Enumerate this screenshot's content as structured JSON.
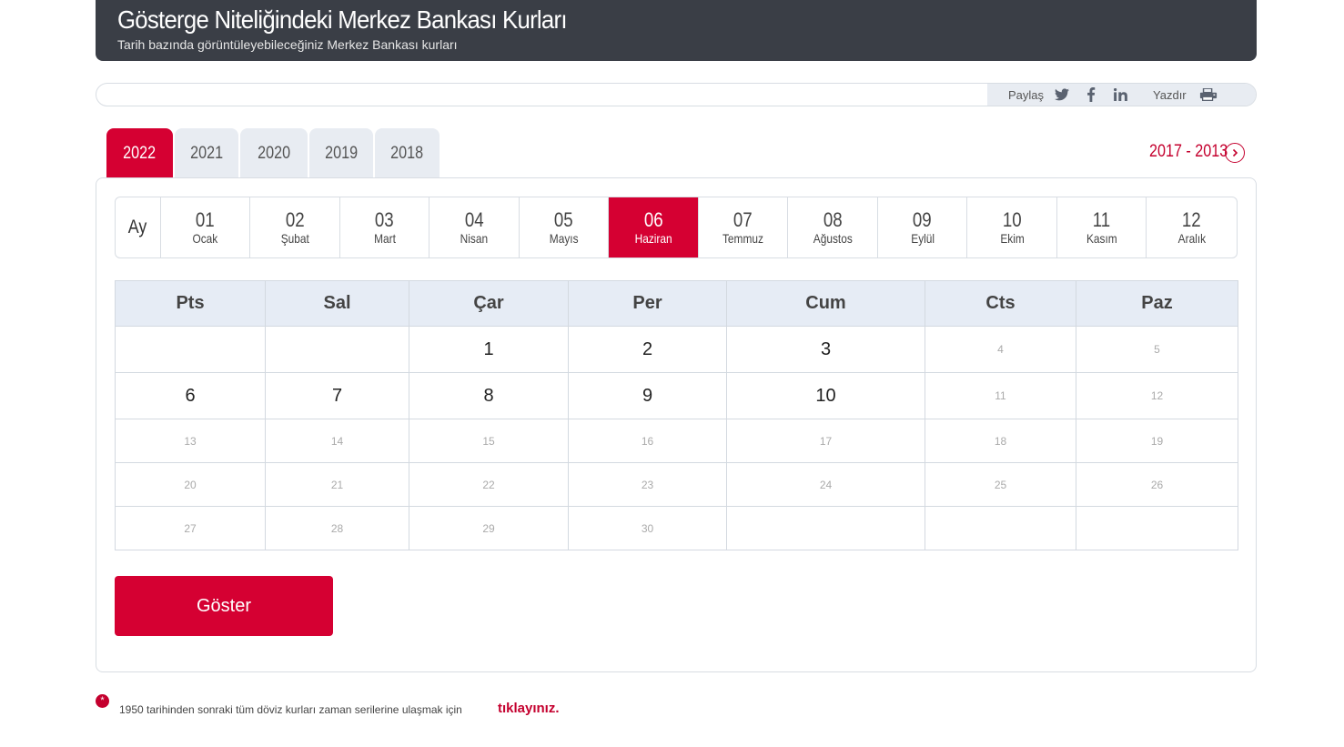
{
  "header": {
    "title": "Gösterge Niteliğindeki Merkez Bankası Kurları",
    "subtitle": "Tarih bazında görüntüleyebileceğiniz Merkez Bankası kurları"
  },
  "sharebar": {
    "share_label": "Paylaş",
    "print_label": "Yazdır",
    "icons": [
      "twitter-icon",
      "facebook-icon",
      "linkedin-icon",
      "printer-icon"
    ]
  },
  "year_tabs": [
    {
      "label": "2022",
      "active": true
    },
    {
      "label": "2021",
      "active": false
    },
    {
      "label": "2020",
      "active": false
    },
    {
      "label": "2019",
      "active": false
    },
    {
      "label": "2018",
      "active": false
    }
  ],
  "range_link": "2017 - 2013",
  "months": {
    "label": "Ay",
    "items": [
      {
        "num": "01",
        "name": "Ocak"
      },
      {
        "num": "02",
        "name": "Şubat"
      },
      {
        "num": "03",
        "name": "Mart"
      },
      {
        "num": "04",
        "name": "Nisan"
      },
      {
        "num": "05",
        "name": "Mayıs"
      },
      {
        "num": "06",
        "name": "Haziran"
      },
      {
        "num": "07",
        "name": "Temmuz"
      },
      {
        "num": "08",
        "name": "Ağustos"
      },
      {
        "num": "09",
        "name": "Eylül"
      },
      {
        "num": "10",
        "name": "Ekim"
      },
      {
        "num": "11",
        "name": "Kasım"
      },
      {
        "num": "12",
        "name": "Aralık"
      }
    ],
    "selected": "06"
  },
  "calendar": {
    "days": [
      "Pts",
      "Sal",
      "Çar",
      "Per",
      "Cum",
      "Cts",
      "Paz"
    ],
    "rows": [
      [
        "",
        "",
        "1",
        "2",
        "3",
        "4",
        "5"
      ],
      [
        "6",
        "7",
        "8",
        "9",
        "10",
        "11",
        "12"
      ],
      [
        "13",
        "14",
        "15",
        "16",
        "17",
        "18",
        "19"
      ],
      [
        "20",
        "21",
        "22",
        "23",
        "24",
        "25",
        "26"
      ],
      [
        "27",
        "28",
        "29",
        "30",
        "",
        "",
        ""
      ]
    ],
    "available_days": [
      "1",
      "2",
      "3",
      "6",
      "7",
      "8",
      "9",
      "10"
    ]
  },
  "show_button": "Göster",
  "footnote": {
    "text": "1950 tarihinden sonraki tüm döviz kurları zaman serilerine ulaşmak için",
    "link": "tıklayınız.",
    "marker": "*"
  },
  "colors": {
    "accent": "#d50032",
    "header_bg": "#3a3e46",
    "tab_bg": "#e8ecf2",
    "calendar_header_bg": "#e6ecf5"
  }
}
